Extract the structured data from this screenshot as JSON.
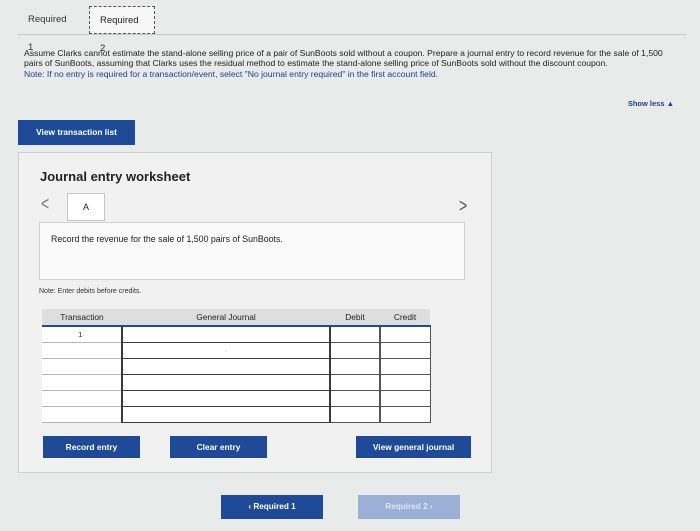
{
  "tabs": [
    {
      "label": "Required 1"
    },
    {
      "label": "Required 2"
    }
  ],
  "instructions": {
    "text": "Assume Clarks cannot estimate the stand-alone selling price of a pair of SunBoots sold without a coupon. Prepare a journal entry to record revenue for the sale of 1,500 pairs of SunBoots, assuming that Clarks uses the residual method to estimate the stand-alone selling price of SunBoots sold without the discount coupon.",
    "note": "Note: If no entry is required for a transaction/event, select \"No journal entry required\" in the first account field."
  },
  "show_less": "Show less ▲",
  "view_transaction_list": "View transaction list",
  "worksheet": {
    "title": "Journal entry worksheet",
    "prev_icon": "chevron-left-icon",
    "next_icon": "chevron-right-icon",
    "entry_label": "A",
    "description": "Record the revenue for the sale of 1,500 pairs of SunBoots.",
    "hint": "Note: Enter debits before credits.",
    "table": {
      "headers": {
        "transaction": "Transaction",
        "general_journal": "General Journal",
        "debit": "Debit",
        "credit": "Credit"
      },
      "first_transaction": "1"
    },
    "buttons": {
      "record": "Record entry",
      "clear": "Clear entry",
      "view_general_journal": "View general journal"
    }
  },
  "navigation": {
    "prev": "‹  Required 1",
    "next": "Required 2  ›"
  }
}
